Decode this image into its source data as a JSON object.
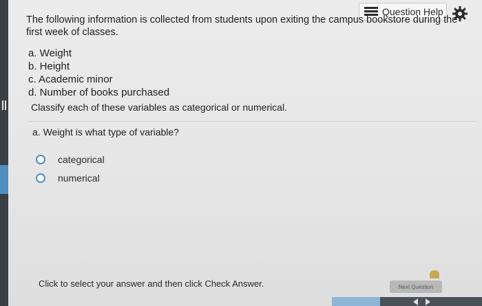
{
  "header": {
    "help_label": "Question Help",
    "help_icon": "list-icon",
    "settings_icon": "gear-icon"
  },
  "question": {
    "intro": "The following information is collected from students upon exiting the campus bookstore during the first week of classes.",
    "items": [
      "a. Weight",
      "b. Height",
      "c. Academic minor",
      "d. Number of books purchased"
    ],
    "instruction": "Classify each of these variables as categorical or numerical.",
    "prompt": "a. Weight is what type of variable?",
    "options": [
      "categorical",
      "numerical"
    ]
  },
  "footer": {
    "instruction": "Click to select your answer and then click Check Answer.",
    "next_label": "Next Question"
  },
  "colors": {
    "radio_accent": "#4a8fc6",
    "left_accent": "#4f8fc0"
  }
}
